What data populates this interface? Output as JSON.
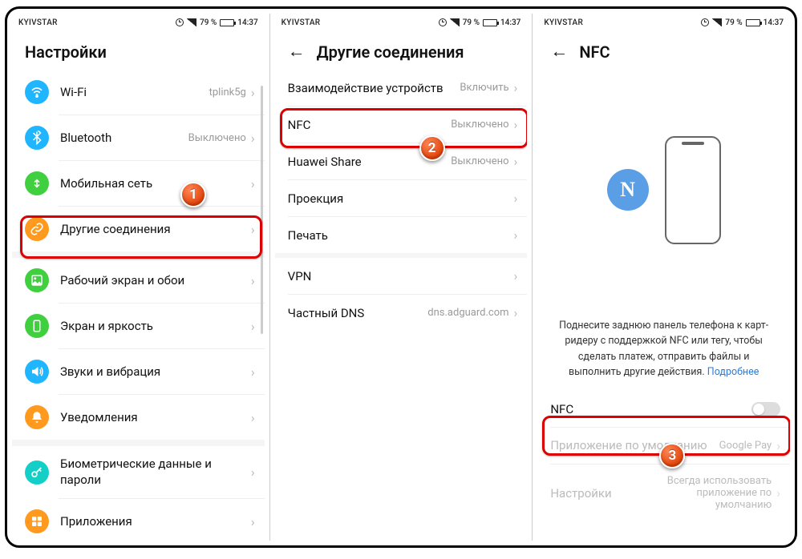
{
  "status": {
    "carrier": "KYIVSTAR",
    "battery": "79 %",
    "time": "14:37"
  },
  "screen1": {
    "title": "Настройки",
    "items": [
      {
        "icon": "wifi",
        "color": "#1fb6ff",
        "label": "Wi-Fi",
        "value": "tplink5g"
      },
      {
        "icon": "bluetooth",
        "color": "#1fb6ff",
        "label": "Bluetooth",
        "value": "Выключено"
      },
      {
        "icon": "mobile",
        "color": "#3fcf3f",
        "label": "Мобильная сеть",
        "value": ""
      },
      {
        "icon": "link",
        "color": "#ff9a1f",
        "label": "Другие соединения",
        "value": ""
      },
      {
        "icon": "wallpaper",
        "color": "#3fcf3f",
        "label": "Рабочий экран и обои",
        "value": ""
      },
      {
        "icon": "display",
        "color": "#3fcf3f",
        "label": "Экран и яркость",
        "value": ""
      },
      {
        "icon": "sound",
        "color": "#1fb6ff",
        "label": "Звуки и вибрация",
        "value": ""
      },
      {
        "icon": "bell",
        "color": "#ff9a1f",
        "label": "Уведомления",
        "value": ""
      },
      {
        "icon": "key",
        "color": "#14cfc8",
        "label": "Биометрические данные и пароли",
        "value": ""
      },
      {
        "icon": "apps",
        "color": "#ff9a1f",
        "label": "Приложения",
        "value": ""
      }
    ]
  },
  "screen2": {
    "title": "Другие соединения",
    "items": [
      {
        "label": "Взаимодействие устройств",
        "value": "Включить"
      },
      {
        "label": "NFC",
        "value": "Выключено"
      },
      {
        "label": "Huawei Share",
        "value": "Выключено"
      },
      {
        "label": "Проекция",
        "value": ""
      },
      {
        "label": "Печать",
        "value": ""
      },
      {
        "label": "VPN",
        "value": ""
      },
      {
        "label": "Частный DNS",
        "value": "dns.adguard.com"
      }
    ]
  },
  "screen3": {
    "title": "NFC",
    "desc": "Поднесите заднюю панель телефона к карт-ридеру с поддержкой NFC или тегу, чтобы сделать платеж, отправить файлы и выполнить другие действия.",
    "more": "Подробнее",
    "toggle_label": "NFC",
    "default_app_label": "Приложение по умолчанию",
    "default_app_value": "Google Pay",
    "settings_label": "Настройки",
    "settings_value": "Всегда использовать приложение по умолчанию"
  },
  "badges": {
    "1": "1",
    "2": "2",
    "3": "3"
  }
}
